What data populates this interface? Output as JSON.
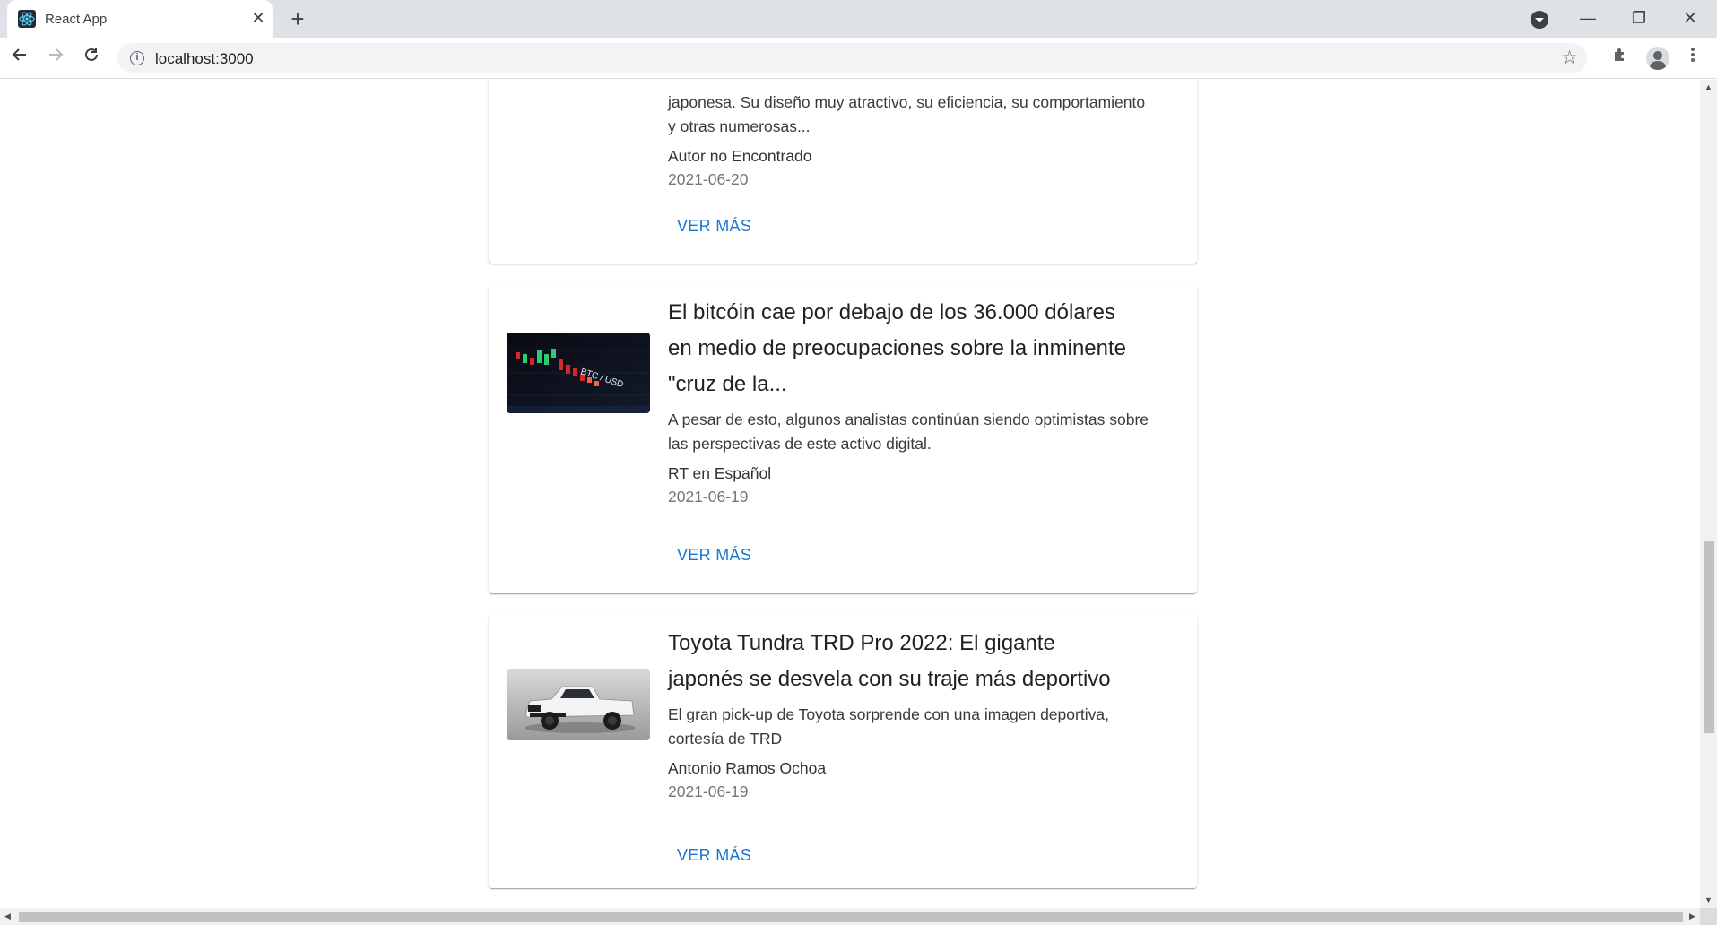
{
  "browser": {
    "tab_title": "React App",
    "tab_close": "✕",
    "new_tab": "+",
    "url": "localhost:3000",
    "window_controls": {
      "minimize": "—",
      "restore": "❐",
      "close": "✕"
    },
    "icons": [
      "react-favicon-icon",
      "back-icon",
      "forward-icon",
      "reload-icon",
      "info-icon",
      "star-icon",
      "extensions-icon",
      "avatar-icon",
      "menu-icon"
    ]
  },
  "articles": [
    {
      "title": "",
      "description_lines": [
        "japonesa. Su diseño muy atractivo, su eficiencia, su comportamiento",
        "y otras numerosas..."
      ],
      "author": "Autor no Encontrado",
      "date": "2021-06-20",
      "button": "VER MÁS"
    },
    {
      "title_lines": [
        "El bitcóin cae por debajo de los 36.000 dólares",
        "en medio de preocupaciones sobre la inminente",
        "\"cruz de la..."
      ],
      "description_lines": [
        "A pesar de esto, algunos analistas continúan siendo optimistas sobre",
        "las perspectivas de este activo digital."
      ],
      "author": "RT en Español",
      "date": "2021-06-19",
      "button": "VER MÁS",
      "image_text": "BTC / USD"
    },
    {
      "title_lines": [
        "Toyota Tundra TRD Pro 2022: El gigante",
        "japonés se desvela con su traje más deportivo"
      ],
      "description_lines": [
        "El gran pick-up de Toyota sorprende con una imagen deportiva,",
        "cortesía de TRD"
      ],
      "author": "Antonio Ramos Ochoa",
      "date": "2021-06-19",
      "button": "VER MÁS"
    }
  ],
  "colors": {
    "link_blue": "#1976d2",
    "chrome_bg": "#dee1e6"
  }
}
